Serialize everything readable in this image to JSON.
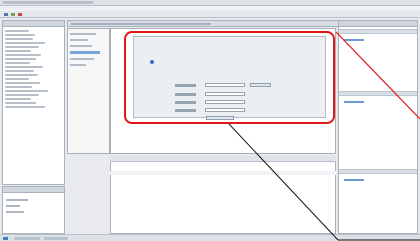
{
  "window": {
    "title": "",
    "brand": "Totally Integrated Automation"
  },
  "left_panel": {
    "title": "",
    "bottom_title": ""
  },
  "editor": {
    "header": "",
    "nav_title": "",
    "main_title": "",
    "paragraph": "",
    "field_labels": [
      "",
      "",
      "",
      ""
    ],
    "field_values": [
      "",
      "",
      "",
      ""
    ],
    "button_label": "",
    "link_text": ""
  },
  "bottom_panel": {
    "tabs": [
      "",
      "",
      ""
    ]
  },
  "right_panel": {
    "title": "",
    "sections": [
      "",
      "",
      ""
    ]
  },
  "colors": {
    "accent": "#e01818",
    "header": "#cfd6de",
    "link": "#6c9ad4"
  }
}
